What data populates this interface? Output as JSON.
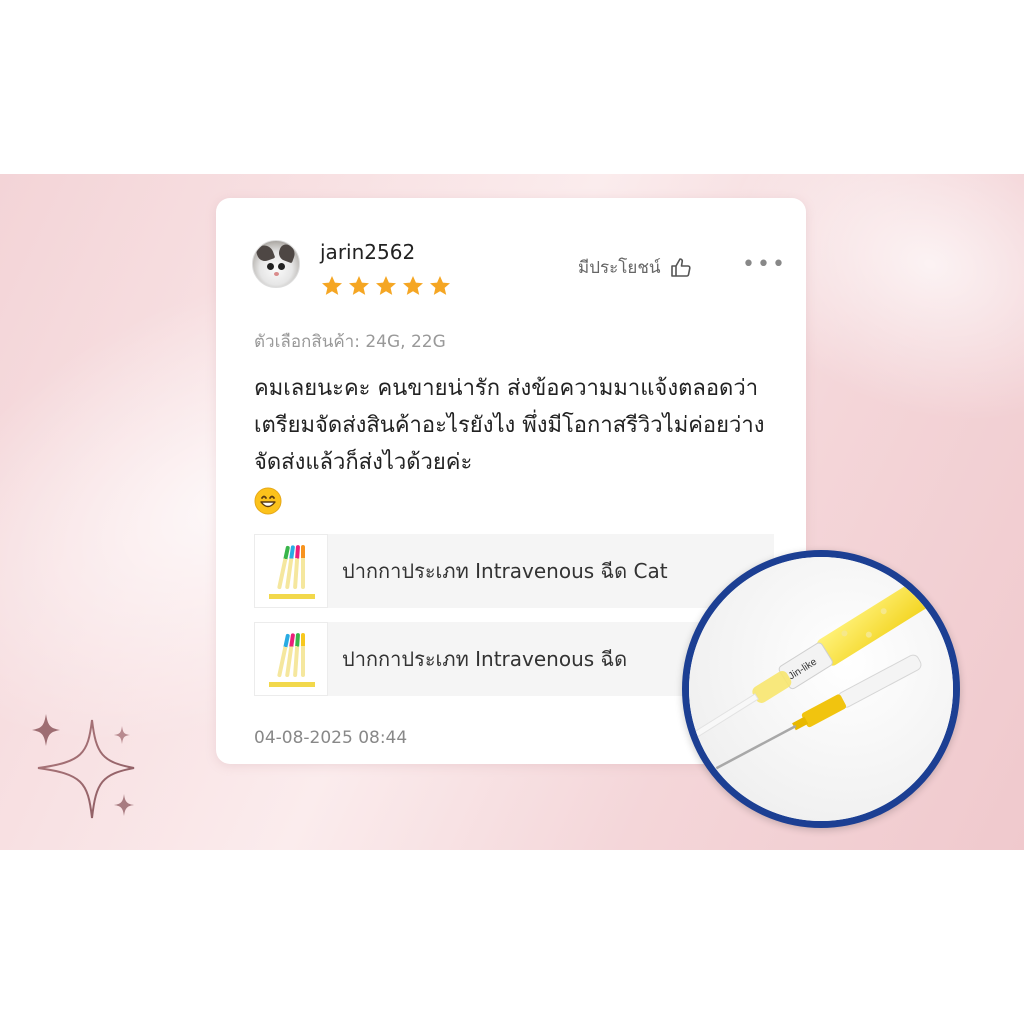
{
  "review": {
    "username": "jarin2562",
    "rating": 5,
    "helpful_label": "มีประโยชน์",
    "more_label": "•••",
    "variant_text": "ตัวเลือกสินค้า: 24G, 22G",
    "body_text": "คมเลยนะคะ คนขายน่ารัก ส่งข้อความมาแจ้งตลอดว่าเตรียมจัดส่งสินค้าอะไรยังไง พึ่งมีโอกาสรีวิวไม่ค่อยว่าง จัดส่งแล้วก็ส่งไวด้วยค่ะ",
    "emoji": "grinning-face",
    "timestamp": "04-08-2025 08:44"
  },
  "products": [
    {
      "title": "ปากกาประเภท Intravenous ฉีด Cat"
    },
    {
      "title": "ปากกาประเภท Intravenous ฉีด"
    }
  ],
  "colors": {
    "star": "#f5a623",
    "zoom_border": "#1c3f93",
    "banner": "#f4d6d9"
  },
  "zoom": {
    "label_text": "Jin-like"
  }
}
